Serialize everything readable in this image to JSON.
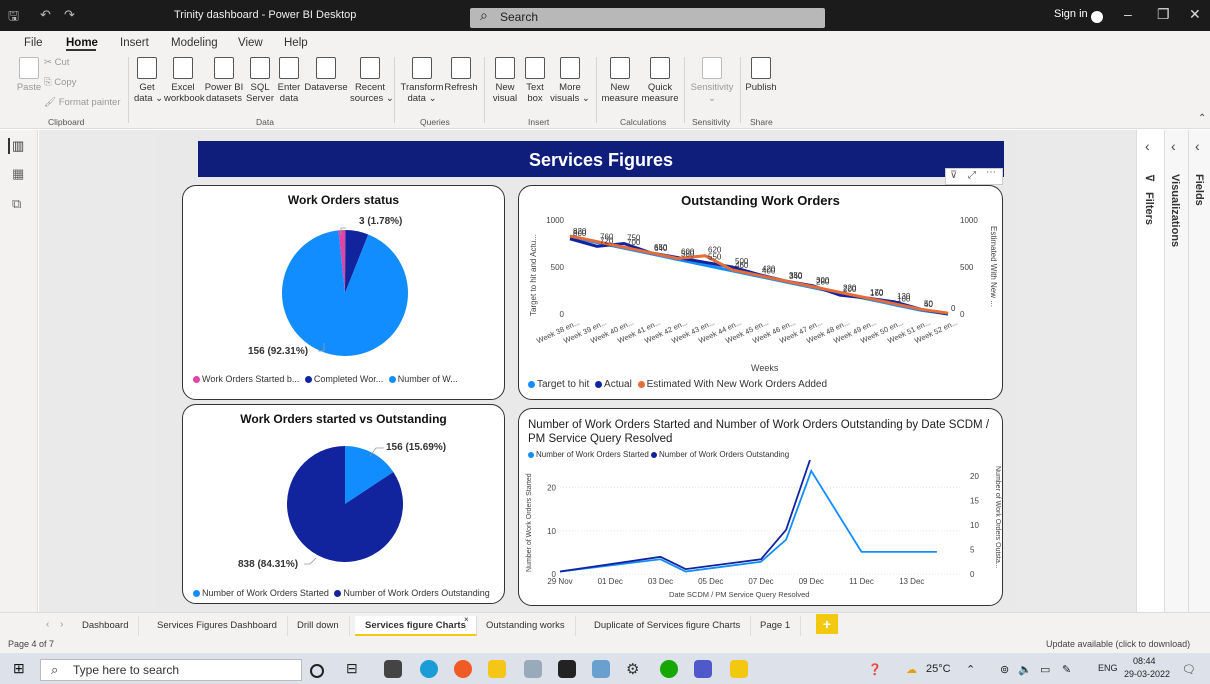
{
  "window": {
    "title": "Trinity dashboard - Power BI Desktop",
    "search_placeholder": "Search",
    "sign_in": "Sign in"
  },
  "menu": [
    "File",
    "Home",
    "Insert",
    "Modeling",
    "View",
    "Help"
  ],
  "ribbon": {
    "clipboard": {
      "paste": "Paste",
      "cut": "Cut",
      "copy": "Copy",
      "format_painter": "Format painter",
      "group": "Clipboard"
    },
    "data": {
      "get_data": "Get\ndata ⌄",
      "excel": "Excel\nworkbook",
      "powerbi": "Power BI\ndatasets",
      "sql": "SQL\nServer",
      "enter": "Enter\ndata",
      "dataverse": "Dataverse",
      "recent": "Recent\nsources ⌄",
      "group": "Data"
    },
    "queries": {
      "transform": "Transform\ndata ⌄",
      "refresh": "Refresh",
      "group": "Queries"
    },
    "insert": {
      "new_visual": "New\nvisual",
      "text_box": "Text\nbox",
      "more_visuals": "More\nvisuals ⌄",
      "group": "Insert"
    },
    "calculations": {
      "new_measure": "New\nmeasure",
      "quick_measure": "Quick\nmeasure",
      "group": "Calculations"
    },
    "sensitivity": {
      "label": "Sensitivity\n⌄",
      "group": "Sensitivity"
    },
    "share": {
      "publish": "Publish",
      "group": "Share"
    }
  },
  "report": {
    "header": "Services Figures",
    "wo_status": {
      "title": "Work Orders status",
      "label_small": "3 (1.78%)",
      "label_large": "156 (92.31%)",
      "legend": [
        "Work Orders Started b...",
        "Completed Wor...",
        "Number of W..."
      ]
    },
    "outstanding": {
      "title": "Outstanding Work Orders",
      "ylabel_left": "Target to hit and Actu...",
      "ylabel_right": "Estimated With New ...",
      "xlabel": "Weeks",
      "legend": [
        "Target to hit",
        "Actual",
        "Estimated With New Work Orders Added"
      ]
    },
    "started_vs": {
      "title": "Work Orders started vs Outstanding",
      "label_small": "156 (15.69%)",
      "label_large": "838 (84.31%)",
      "legend": [
        "Number of Work Orders Started",
        "Number of Work Orders Outstanding"
      ]
    },
    "by_date": {
      "title": "Number of Work Orders Started and Number of Work Orders Outstanding by Date SCDM / PM Service Query Resolved",
      "legend": [
        "Number of Work Orders Started",
        "Number of Work Orders Outstanding"
      ],
      "ylabel_left": "Number of Work Orders Started",
      "ylabel_right": "Number of Work Orders Outsta...",
      "xlabel": "Date SCDM / PM Service Query Resolved"
    }
  },
  "chart_data": [
    {
      "type": "pie",
      "title": "Work Orders status",
      "labels": [
        "Work Orders Started b...",
        "Completed Wor...",
        "Number of W..."
      ],
      "values": [
        3,
        10,
        156
      ],
      "colors": [
        "#e044a7",
        "#12239e",
        "#118dff"
      ]
    },
    {
      "type": "line",
      "title": "Outstanding Work Orders",
      "categories": [
        "Week 38 en...",
        "Week 39 en...",
        "Week 40 en...",
        "Week 41 en...",
        "Week 42 en...",
        "Week 43 en...",
        "Week 44 en...",
        "Week 45 en...",
        "Week 46 en...",
        "Week 47 en...",
        "Week 48 en...",
        "Week 49 en...",
        "Week 50 en...",
        "Week 51 en...",
        "Week 52 en..."
      ],
      "xlabel": "Weeks",
      "ylim": [
        0,
        1000
      ],
      "series": [
        {
          "name": "Target to hit",
          "color": "#118dff",
          "values": [
            820,
            760,
            700,
            640,
            580,
            520,
            460,
            400,
            340,
            280,
            220,
            160,
            100,
            40,
            0
          ]
        },
        {
          "name": "Actual",
          "color": "#12239e",
          "values": [
            800,
            720,
            750,
            650,
            600,
            550,
            500,
            420,
            350,
            300,
            200,
            170,
            130,
            50,
            0
          ]
        },
        {
          "name": "Estimated With New Work Orders Added",
          "color": "#e66c37",
          "values": [
            830,
            770,
            710,
            650,
            590,
            620,
            470,
            410,
            350,
            290,
            230,
            170,
            110,
            50,
            10
          ]
        }
      ],
      "data_labels": [
        {
          "x": 0,
          "y": 820,
          "text": "820"
        },
        {
          "x": 0,
          "y": 800,
          "text": "800"
        },
        {
          "x": 1,
          "y": 760,
          "text": "760"
        },
        {
          "x": 1,
          "y": 720,
          "text": "720"
        },
        {
          "x": 2,
          "y": 700,
          "text": "700"
        },
        {
          "x": 2,
          "y": 750,
          "text": "750"
        },
        {
          "x": 3,
          "y": 640,
          "text": "640"
        },
        {
          "x": 3,
          "y": 650,
          "text": "650"
        },
        {
          "x": 4,
          "y": 580,
          "text": "580"
        },
        {
          "x": 4,
          "y": 600,
          "text": "600"
        },
        {
          "x": 5,
          "y": 620,
          "text": "620"
        },
        {
          "x": 5,
          "y": 550,
          "text": "550"
        },
        {
          "x": 6,
          "y": 460,
          "text": "460"
        },
        {
          "x": 6,
          "y": 500,
          "text": "500"
        },
        {
          "x": 7,
          "y": 400,
          "text": "400"
        },
        {
          "x": 7,
          "y": 420,
          "text": "420"
        },
        {
          "x": 8,
          "y": 340,
          "text": "340"
        },
        {
          "x": 8,
          "y": 350,
          "text": "350"
        },
        {
          "x": 9,
          "y": 280,
          "text": "280"
        },
        {
          "x": 9,
          "y": 300,
          "text": "300"
        },
        {
          "x": 10,
          "y": 220,
          "text": "220"
        },
        {
          "x": 10,
          "y": 200,
          "text": "200"
        },
        {
          "x": 11,
          "y": 160,
          "text": "160"
        },
        {
          "x": 11,
          "y": 170,
          "text": "170"
        },
        {
          "x": 12,
          "y": 100,
          "text": "100"
        },
        {
          "x": 12,
          "y": 130,
          "text": "130"
        },
        {
          "x": 13,
          "y": 40,
          "text": "40"
        },
        {
          "x": 13,
          "y": 50,
          "text": "50"
        },
        {
          "x": 14,
          "y": 0,
          "text": "0"
        }
      ]
    },
    {
      "type": "pie",
      "title": "Work Orders started vs Outstanding",
      "labels": [
        "Number of Work Orders Started",
        "Number of Work Orders Outstanding"
      ],
      "values": [
        156,
        838
      ],
      "colors": [
        "#118dff",
        "#12239e"
      ]
    },
    {
      "type": "line",
      "title": "Number of Work Orders Started and Number of Work Orders Outstanding by Date SCDM / PM Service Query Resolved",
      "x_ticks": [
        "29 Nov",
        "01 Dec",
        "03 Dec",
        "05 Dec",
        "07 Dec",
        "09 Dec",
        "11 Dec",
        "13 Dec"
      ],
      "x": [
        0,
        4,
        5,
        8,
        9,
        10,
        12,
        14,
        15
      ],
      "ylim_left": [
        0,
        25
      ],
      "yticks_left": [
        0,
        10,
        20
      ],
      "ylim_right": [
        0,
        22
      ],
      "yticks_right": [
        0,
        5,
        10,
        15,
        20
      ],
      "series": [
        {
          "name": "Number of Work Orders Started",
          "color": "#118dff",
          "axis": "right",
          "values": [
            0.5,
            3.0,
            0.5,
            2.5,
            7.0,
            21.0,
            4.5,
            4.5,
            4.5
          ]
        },
        {
          "name": "Number of Work Orders Outstanding",
          "color": "#12239e",
          "axis": "right",
          "values": [
            0.5,
            3.5,
            1.0,
            3.0,
            9.0,
            24.0,
            null,
            null,
            null
          ]
        }
      ]
    }
  ],
  "tabs": [
    "Dashboard",
    "Services Figures Dashboard",
    "Drill down",
    "Services figure Charts",
    "Outstanding works",
    "Duplicate of Services figure Charts",
    "Page 1"
  ],
  "active_tab": "Services figure Charts",
  "status": {
    "page": "Page 4 of 7",
    "update": "Update available (click to download)"
  },
  "panes": {
    "filters": "Filters",
    "visualizations": "Visualizations",
    "fields": "Fields"
  },
  "taskbar": {
    "search": "Type here to search",
    "temp": "25°C",
    "lang": "ENG",
    "time": "08:44",
    "date": "29-03-2022"
  }
}
